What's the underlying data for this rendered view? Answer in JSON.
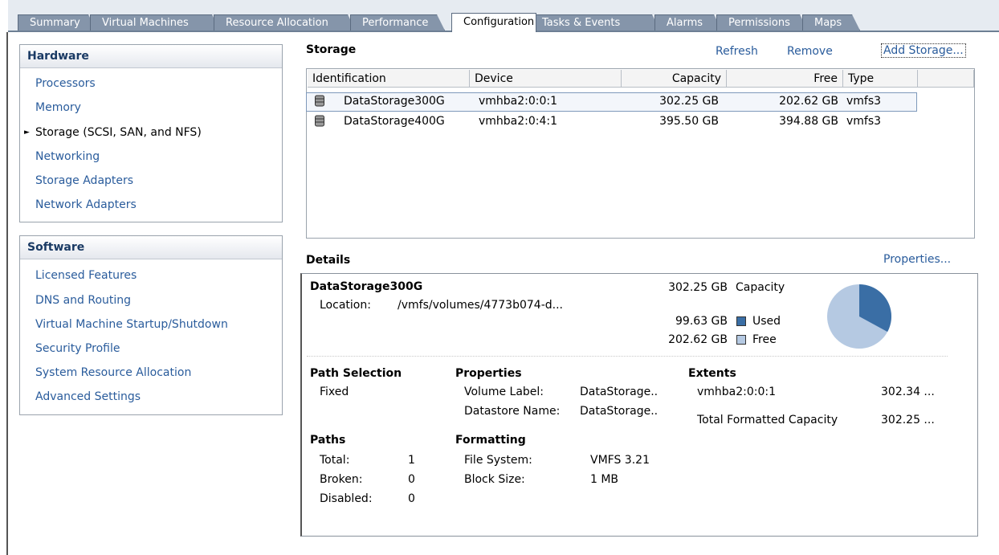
{
  "tabs": [
    {
      "label": "Summary"
    },
    {
      "label": "Virtual Machines"
    },
    {
      "label": "Resource Allocation"
    },
    {
      "label": "Performance"
    },
    {
      "label": "Configuration",
      "active": true
    },
    {
      "label": "Tasks & Events"
    },
    {
      "label": "Alarms"
    },
    {
      "label": "Permissions"
    },
    {
      "label": "Maps"
    }
  ],
  "hardware": {
    "title": "Hardware",
    "items": [
      "Processors",
      "Memory",
      "Storage (SCSI, SAN, and NFS)",
      "Networking",
      "Storage Adapters",
      "Network Adapters"
    ],
    "selected_index": 2
  },
  "software": {
    "title": "Software",
    "items": [
      "Licensed Features",
      "DNS and Routing",
      "Virtual Machine Startup/Shutdown",
      "Security Profile",
      "System Resource Allocation",
      "Advanced Settings"
    ]
  },
  "storage": {
    "title": "Storage",
    "refresh": "Refresh",
    "remove": "Remove",
    "add": "Add Storage...",
    "columns": [
      "Identification",
      "Device",
      "Capacity",
      "Free",
      "Type"
    ],
    "rows": [
      {
        "id": "DataStorage300G",
        "device": "vmhba2:0:0:1",
        "capacity": "302.25 GB",
        "free": "202.62 GB",
        "type": "vmfs3",
        "selected": true
      },
      {
        "id": "DataStorage400G",
        "device": "vmhba2:0:4:1",
        "capacity": "395.50 GB",
        "free": "394.88 GB",
        "type": "vmfs3"
      }
    ]
  },
  "details": {
    "title": "Details",
    "properties_link": "Properties...",
    "name": "DataStorage300G",
    "location_label": "Location:",
    "location_value": "/vmfs/volumes/4773b074-d...",
    "capacity_value": "302.25 GB",
    "capacity_label": "Capacity",
    "used_value": "99.63 GB",
    "used_label": "Used",
    "free_value": "202.62 GB",
    "free_label": "Free",
    "used_fraction": 0.3296,
    "colors": {
      "used": "#3a6ea5",
      "free": "#b5c9e2"
    },
    "path_selection": {
      "title": "Path Selection",
      "value": "Fixed"
    },
    "properties": {
      "title": "Properties",
      "volume_label_label": "Volume Label:",
      "volume_label_value": "DataStorage..",
      "datastore_name_label": "Datastore Name:",
      "datastore_name_value": "DataStorage.."
    },
    "extents": {
      "title": "Extents",
      "device": "vmhba2:0:0:1",
      "device_size": "302.34 ...",
      "total_label": "Total Formatted Capacity",
      "total_value": "302.25 ..."
    },
    "paths": {
      "title": "Paths",
      "total_label": "Total:",
      "total_value": "1",
      "broken_label": "Broken:",
      "broken_value": "0",
      "disabled_label": "Disabled:",
      "disabled_value": "0"
    },
    "formatting": {
      "title": "Formatting",
      "fs_label": "File System:",
      "fs_value": "VMFS 3.21",
      "block_label": "Block Size:",
      "block_value": "1 MB"
    }
  }
}
